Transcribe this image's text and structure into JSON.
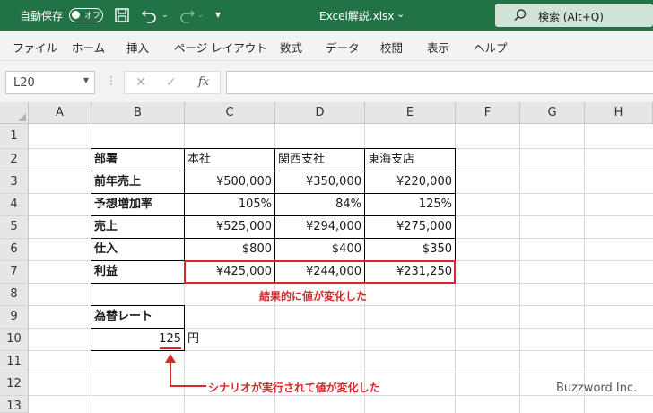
{
  "titlebar": {
    "autosave_label": "自動保存",
    "autosave_state": "オフ",
    "filename": "Excel解説.xlsx",
    "search_label": "検索 (Alt+Q)",
    "brand_color": "#217346"
  },
  "menu": {
    "items": [
      "ファイル",
      "ホーム",
      "挿入",
      "ページ レイアウト",
      "数式",
      "データ",
      "校閲",
      "表示",
      "ヘルプ"
    ]
  },
  "formula_bar": {
    "name_box": "L20",
    "fx_label": "fx",
    "formula": ""
  },
  "sheet": {
    "columns": [
      "A",
      "B",
      "C",
      "D",
      "E",
      "F",
      "G",
      "H"
    ],
    "rows": [
      "1",
      "2",
      "3",
      "4",
      "5",
      "6",
      "7",
      "8",
      "9",
      "10",
      "11",
      "12",
      "13"
    ],
    "table_header": [
      "部署",
      "本社",
      "関西支社",
      "東海支店"
    ],
    "table_rows": [
      {
        "label": "前年売上",
        "values": [
          "¥500,000",
          "¥350,000",
          "¥220,000"
        ]
      },
      {
        "label": "予想増加率",
        "values": [
          "105%",
          "84%",
          "125%"
        ]
      },
      {
        "label": "売上",
        "values": [
          "¥525,000",
          "¥294,000",
          "¥275,000"
        ]
      },
      {
        "label": "仕入",
        "values": [
          "$800",
          "$400",
          "$350"
        ]
      },
      {
        "label": "利益",
        "values": [
          "¥425,000",
          "¥244,000",
          "¥231,250"
        ]
      }
    ],
    "rate_label": "為替レート",
    "rate_value": "125",
    "rate_unit": "円"
  },
  "annotations": {
    "result_note": "結果的に値が変化した",
    "scenario_note": "シナリオが実行されて値が変化した",
    "highlight_color": "#d42a2a"
  },
  "watermark": "Buzzword Inc."
}
